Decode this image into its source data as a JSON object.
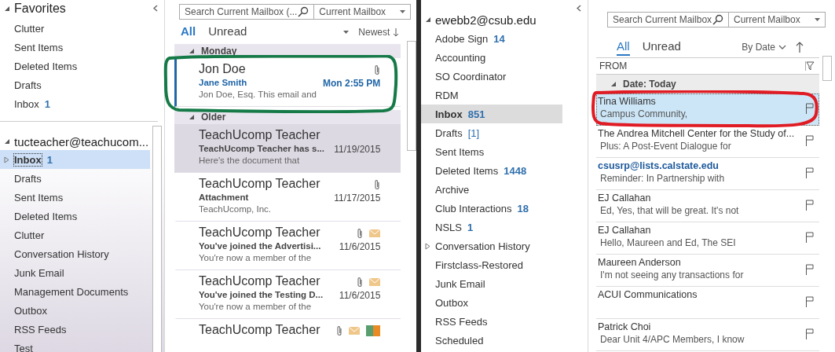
{
  "left_window": {
    "folder_pane": {
      "favorites": {
        "title": "Favorites",
        "expanded": true,
        "items": [
          {
            "label": "Clutter",
            "selected": false,
            "bold": false,
            "expandable": false
          },
          {
            "label": "Sent Items",
            "selected": false,
            "bold": false,
            "expandable": false
          },
          {
            "label": "Deleted Items",
            "selected": false,
            "bold": false,
            "expandable": false
          },
          {
            "label": "Drafts",
            "selected": false,
            "bold": false,
            "expandable": false
          },
          {
            "label": "Inbox",
            "count": "1",
            "count_bold": true,
            "selected": false,
            "bold": false,
            "expandable": false
          }
        ]
      },
      "account": {
        "title": "tucteacher@teachucom...",
        "expanded": true,
        "items": [
          {
            "label": "Inbox",
            "count": "1",
            "count_bold": true,
            "selected": true,
            "bold": true,
            "expandable": true
          },
          {
            "label": "Drafts",
            "selected": false,
            "bold": false,
            "expandable": false
          },
          {
            "label": "Sent Items",
            "selected": false,
            "bold": false,
            "expandable": false
          },
          {
            "label": "Deleted Items",
            "selected": false,
            "bold": false,
            "expandable": false
          },
          {
            "label": "Clutter",
            "selected": false,
            "bold": false,
            "expandable": false
          },
          {
            "label": "Conversation History",
            "selected": false,
            "bold": false,
            "expandable": false
          },
          {
            "label": "Junk Email",
            "selected": false,
            "bold": false,
            "expandable": false
          },
          {
            "label": "Management Documents",
            "selected": false,
            "bold": false,
            "expandable": false
          },
          {
            "label": "Outbox",
            "selected": false,
            "bold": false,
            "expandable": false
          },
          {
            "label": "RSS Feeds",
            "selected": false,
            "bold": false,
            "expandable": false
          },
          {
            "label": "Test",
            "selected": false,
            "bold": false,
            "expandable": false
          }
        ]
      }
    },
    "search": {
      "placeholder": "Search Current Mailbox (...",
      "scope": "Current Mailbox"
    },
    "filters": [
      {
        "label": "All",
        "selected": true
      },
      {
        "label": "Unread",
        "selected": false
      }
    ],
    "sort": "Newest",
    "groups": [
      {
        "title": "Monday",
        "expanded": true,
        "messages": [
          {
            "sender": "Jon Doe",
            "subject": "Jane Smith",
            "date": "Mon 2:55 PM",
            "preview": "Jon Doe, Esq.  This email and",
            "unread": true,
            "selected": false,
            "circled": true,
            "attachment": true,
            "envelope": false,
            "categorized": false
          }
        ]
      },
      {
        "title": "Older",
        "expanded": true,
        "messages": [
          {
            "sender": "TeachUcomp Teacher",
            "subject": "TeachUcomp Teacher has s...",
            "date": "11/19/2015",
            "preview": "Here's the document that",
            "unread": false,
            "selected": true,
            "circled": false,
            "attachment": false,
            "envelope": false,
            "categorized": false
          },
          {
            "sender": "TeachUcomp Teacher",
            "subject": "Attachment",
            "date": "11/17/2015",
            "preview": "TeachUcomp, Inc.",
            "unread": false,
            "selected": false,
            "circled": false,
            "attachment": true,
            "envelope": false,
            "categorized": false
          },
          {
            "sender": "TeachUcomp Teacher",
            "subject": "You've joined the Advertisi...",
            "date": "11/6/2015",
            "preview": "You're now a member of the",
            "unread": false,
            "selected": false,
            "circled": false,
            "attachment": true,
            "envelope": true,
            "categorized": false
          },
          {
            "sender": "TeachUcomp Teacher",
            "subject": "You've joined the Testing D...",
            "date": "11/6/2015",
            "preview": "You're now a member of the",
            "unread": false,
            "selected": false,
            "circled": false,
            "attachment": true,
            "envelope": true,
            "categorized": false
          },
          {
            "sender": "TeachUcomp Teacher",
            "attachment": true,
            "envelope": true,
            "categorized": true,
            "unread": false,
            "selected": false,
            "circled": false
          }
        ]
      }
    ]
  },
  "right_window": {
    "folder_pane": {
      "account": {
        "title": "ewebb2@csub.edu",
        "expanded": true,
        "items": [
          {
            "label": "Adobe Sign",
            "count": "14",
            "count_bold": true,
            "selected": false,
            "bold": false,
            "expandable": false
          },
          {
            "label": "Accounting",
            "selected": false,
            "bold": false,
            "expandable": false
          },
          {
            "label": "SO Coordinator",
            "selected": false,
            "bold": false,
            "expandable": false
          },
          {
            "label": "RDM",
            "selected": false,
            "bold": false,
            "expandable": false
          },
          {
            "label": "Inbox",
            "count": "851",
            "count_bold": true,
            "selected": true,
            "bold": true,
            "expandable": false
          },
          {
            "label": "Drafts",
            "count": "[1]",
            "count_bold": false,
            "selected": false,
            "bold": false,
            "expandable": false
          },
          {
            "label": "Sent Items",
            "selected": false,
            "bold": false,
            "expandable": false
          },
          {
            "label": "Deleted Items",
            "count": "1448",
            "count_bold": true,
            "selected": false,
            "bold": false,
            "expandable": false
          },
          {
            "label": "Archive",
            "selected": false,
            "bold": false,
            "expandable": false
          },
          {
            "label": "Club Interactions",
            "count": "18",
            "count_bold": true,
            "selected": false,
            "bold": false,
            "expandable": false
          },
          {
            "label": "NSLS",
            "count": "1",
            "count_bold": true,
            "selected": false,
            "bold": false,
            "expandable": false
          },
          {
            "label": "Conversation History",
            "selected": false,
            "bold": false,
            "expandable": true
          },
          {
            "label": "Firstclass-Restored",
            "selected": false,
            "bold": false,
            "expandable": false
          },
          {
            "label": "Junk Email",
            "selected": false,
            "bold": false,
            "expandable": false
          },
          {
            "label": "Outbox",
            "selected": false,
            "bold": false,
            "expandable": false
          },
          {
            "label": "RSS Feeds",
            "selected": false,
            "bold": false,
            "expandable": false
          },
          {
            "label": "Scheduled",
            "selected": false,
            "bold": false,
            "expandable": false
          }
        ]
      }
    },
    "search": {
      "placeholder": "Search Current Mailbox",
      "scope": "Current Mailbox"
    },
    "filters": [
      {
        "label": "All",
        "selected": true
      },
      {
        "label": "Unread",
        "selected": false
      }
    ],
    "sort": "By Date",
    "column_header": "FROM",
    "groups": [
      {
        "title": "Date: Today",
        "expanded": true,
        "messages": [
          {
            "sender": "Tina Williams",
            "preview": "Campus Community,",
            "unread": false,
            "selected": true,
            "circled": true,
            "flagged": false
          },
          {
            "sender": "The Andrea Mitchell Center for the Study of...",
            "preview": "Plus: A Post-Event Dialogue for",
            "unread": false,
            "selected": false,
            "circled": false,
            "flagged": false
          },
          {
            "sender": "csusrp@lists.calstate.edu",
            "preview": "Reminder: In Partnership with",
            "unread": true,
            "selected": false,
            "circled": false,
            "flagged": false
          },
          {
            "sender": "EJ Callahan",
            "preview": "Ed,   Yes, that will be great. It's not",
            "unread": false,
            "selected": false,
            "circled": false,
            "flagged": false
          },
          {
            "sender": "EJ Callahan",
            "preview": "Hello, Maureen and Ed,   The SEI",
            "unread": false,
            "selected": false,
            "circled": false,
            "flagged": false
          },
          {
            "sender": "Maureen Anderson",
            "preview": "I'm not seeing any transactions for",
            "unread": false,
            "selected": false,
            "circled": false,
            "flagged": false
          },
          {
            "sender": "ACUI Communications",
            "unread": false,
            "selected": false,
            "circled": false,
            "flagged": false
          },
          {
            "sender": "Patrick Choi",
            "preview": "Dear Unit 4/APC Members,  I know",
            "unread": false,
            "selected": false,
            "circled": false,
            "flagged": false
          }
        ]
      }
    ]
  }
}
